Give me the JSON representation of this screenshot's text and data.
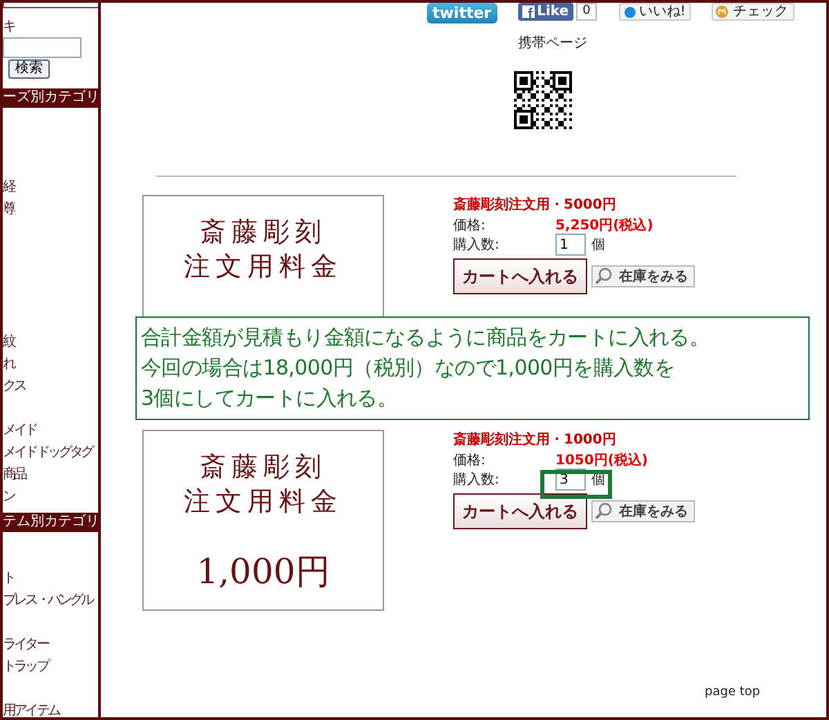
{
  "sidebar": {
    "top_fragment": "キ",
    "search": {
      "button": "検索"
    },
    "sections": [
      {
        "title": "ーズ別カテゴリ",
        "groups": [
          [
            "経",
            "尊"
          ],
          [
            "紋",
            "れ",
            "クス"
          ],
          [
            "メイド",
            "メイドドッグタグ",
            "商品",
            "ン"
          ]
        ]
      },
      {
        "title": "テム別カテゴリ",
        "groups": [
          [
            "ト",
            "ブレス・バングル"
          ],
          [
            "ライター",
            "トラップ"
          ],
          [
            "用アイテム"
          ]
        ]
      }
    ]
  },
  "share": {
    "twitter": "twitter",
    "facebook": "Like",
    "like_count": "0",
    "iine": "いいね!",
    "check": "チェック"
  },
  "mobile": {
    "label": "携帯ページ"
  },
  "products": [
    {
      "image_lines": [
        "斎藤彫刻",
        "注文用料金"
      ],
      "title": "斎藤彫刻注文用・5000円",
      "price_label": "価格:",
      "price": "5,250円(税込)",
      "qty_label": "購入数:",
      "qty": "1",
      "unit": "個",
      "cart_button": "カートへ入れる",
      "stock_button": "在庫をみる",
      "highlighted": false
    },
    {
      "image_lines": [
        "斎藤彫刻",
        "注文用料金",
        "1,000円"
      ],
      "title": "斎藤彫刻注文用・1000円",
      "price_label": "価格:",
      "price": "1050円(税込)",
      "qty_label": "購入数:",
      "qty": "3",
      "unit": "個",
      "cart_button": "カートへ入れる",
      "stock_button": "在庫をみる",
      "highlighted": true
    }
  ],
  "callout": {
    "lines": [
      "合計金額が見積もり金額になるように商品をカートに入れる。",
      "今回の場合は18,000円（税別）なので1,000円を購入数を",
      "3個にしてカートに入れる。"
    ]
  },
  "page_top": "page top"
}
